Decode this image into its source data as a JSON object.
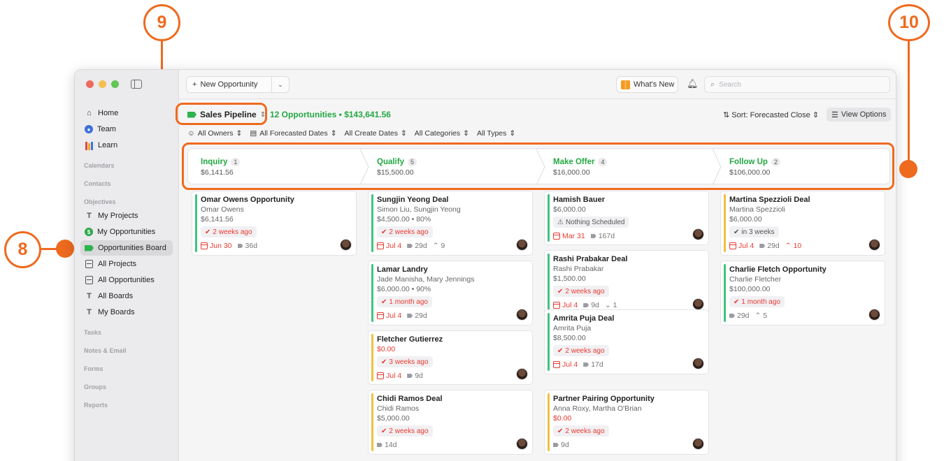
{
  "window": {
    "colors": {
      "accent": "#23a843",
      "alert": "#e83b30",
      "annotation": "#ee6a1f"
    }
  },
  "sidebar": {
    "items": [
      {
        "label": "Home",
        "icon": "home-icon"
      },
      {
        "label": "Team",
        "icon": "team-icon"
      },
      {
        "label": "Learn",
        "icon": "books-icon"
      }
    ],
    "sections": {
      "calendars": "Calendars",
      "contacts": "Contacts",
      "objectives": "Objectives",
      "tasks": "Tasks",
      "notes": "Notes & Email",
      "forms": "Forms",
      "groups": "Groups",
      "reports": "Reports"
    },
    "objectives": [
      {
        "label": "My Projects",
        "icon": "t-icon"
      },
      {
        "label": "My Opportunities",
        "icon": "dollar-icon"
      },
      {
        "label": "Opportunities Board",
        "icon": "tag-icon",
        "active": true
      },
      {
        "label": "All Projects",
        "icon": "grid-icon"
      },
      {
        "label": "All Opportunities",
        "icon": "grid-dollar-icon"
      },
      {
        "label": "All Boards",
        "icon": "board-icon"
      },
      {
        "label": "My Boards",
        "icon": "board-icon"
      }
    ]
  },
  "toolbar": {
    "new_opportunity": "New Opportunity",
    "whats_new": "What's New",
    "search_placeholder": "Search"
  },
  "header": {
    "pipeline": "Sales Pipeline",
    "summary": "12 Opportunities • $143,641.56",
    "sort": "Sort: Forecasted Close",
    "view_options": "View Options"
  },
  "filters": [
    "All Owners",
    "All Forecasted Dates",
    "All Create Dates",
    "All Categories",
    "All Types"
  ],
  "stages": [
    {
      "name": "Inquiry",
      "count": "1",
      "amount": "$6,141.56"
    },
    {
      "name": "Qualify",
      "count": "5",
      "amount": "$15,500.00"
    },
    {
      "name": "Make Offer",
      "count": "4",
      "amount": "$16,000.00"
    },
    {
      "name": "Follow Up",
      "count": "2",
      "amount": "$106,000.00"
    }
  ],
  "columns": [
    [
      {
        "title": "Omar Owens Opportunity",
        "sub": "Omar Owens",
        "amount": "$6,141.56",
        "pill": "2 weeks ago",
        "date": "Jun 30",
        "note": "36d",
        "extra": ""
      }
    ],
    [
      {
        "title": "Sungjin Yeong Deal",
        "sub": "Simon Liu, Sungjin Yeong",
        "amount": "$4,500.00 • 80%",
        "pill": "2 weeks ago",
        "date": "Jul 4",
        "note": "29d",
        "extra": "9"
      },
      {
        "title": "Lamar Landry",
        "sub": "Jade Manisha, Mary Jennings",
        "amount": "$6,000.00 • 90%",
        "pill": "1 month ago",
        "date": "Jul 4",
        "note": "29d",
        "extra": ""
      },
      {
        "title": "Fletcher Gutierrez",
        "sub": "",
        "amount": "$0.00",
        "pill": "3 weeks ago",
        "date": "Jul 4",
        "note": "9d",
        "extra": ""
      },
      {
        "title": "Chidi Ramos Deal",
        "sub": "Chidi Ramos",
        "amount": "$5,000.00",
        "pill": "2 weeks ago",
        "date": "",
        "note": "14d",
        "extra": ""
      }
    ],
    [
      {
        "title": "Hamish Bauer",
        "sub": "",
        "amount": "$6,000.00",
        "pill": "Nothing Scheduled",
        "date": "Mar 31",
        "note": "167d",
        "extra": ""
      },
      {
        "title": "Rashi Prabakar Deal",
        "sub": "Rashi Prabakar",
        "amount": "$1,500.00",
        "pill": "2 weeks ago",
        "date": "Jul 4",
        "note": "9d",
        "extra": "1"
      },
      {
        "title": "Amrita Puja Deal",
        "sub": "Amrita Puja",
        "amount": "$8,500.00",
        "pill": "2 weeks ago",
        "date": "Jul 4",
        "note": "17d",
        "extra": ""
      },
      {
        "title": "Partner Pairing Opportunity",
        "sub": "Anna Roxy, Martha O'Brian",
        "amount": "$0.00",
        "pill": "2 weeks ago",
        "date": "",
        "note": "9d",
        "extra": ""
      }
    ],
    [
      {
        "title": "Martina Spezzioli Deal",
        "sub": "Martina Spezzioli",
        "amount": "$6,000.00",
        "pill": "in 3 weeks",
        "date": "Jul 4",
        "note": "29d",
        "extra": "10"
      },
      {
        "title": "Charlie Fletch Opportunity",
        "sub": "Charlie Fletcher",
        "amount": "$100,000.00",
        "pill": "1 month ago",
        "date": "",
        "note": "29d",
        "extra": "5"
      }
    ]
  ],
  "callouts": {
    "eight": "8",
    "nine": "9",
    "ten": "10"
  }
}
